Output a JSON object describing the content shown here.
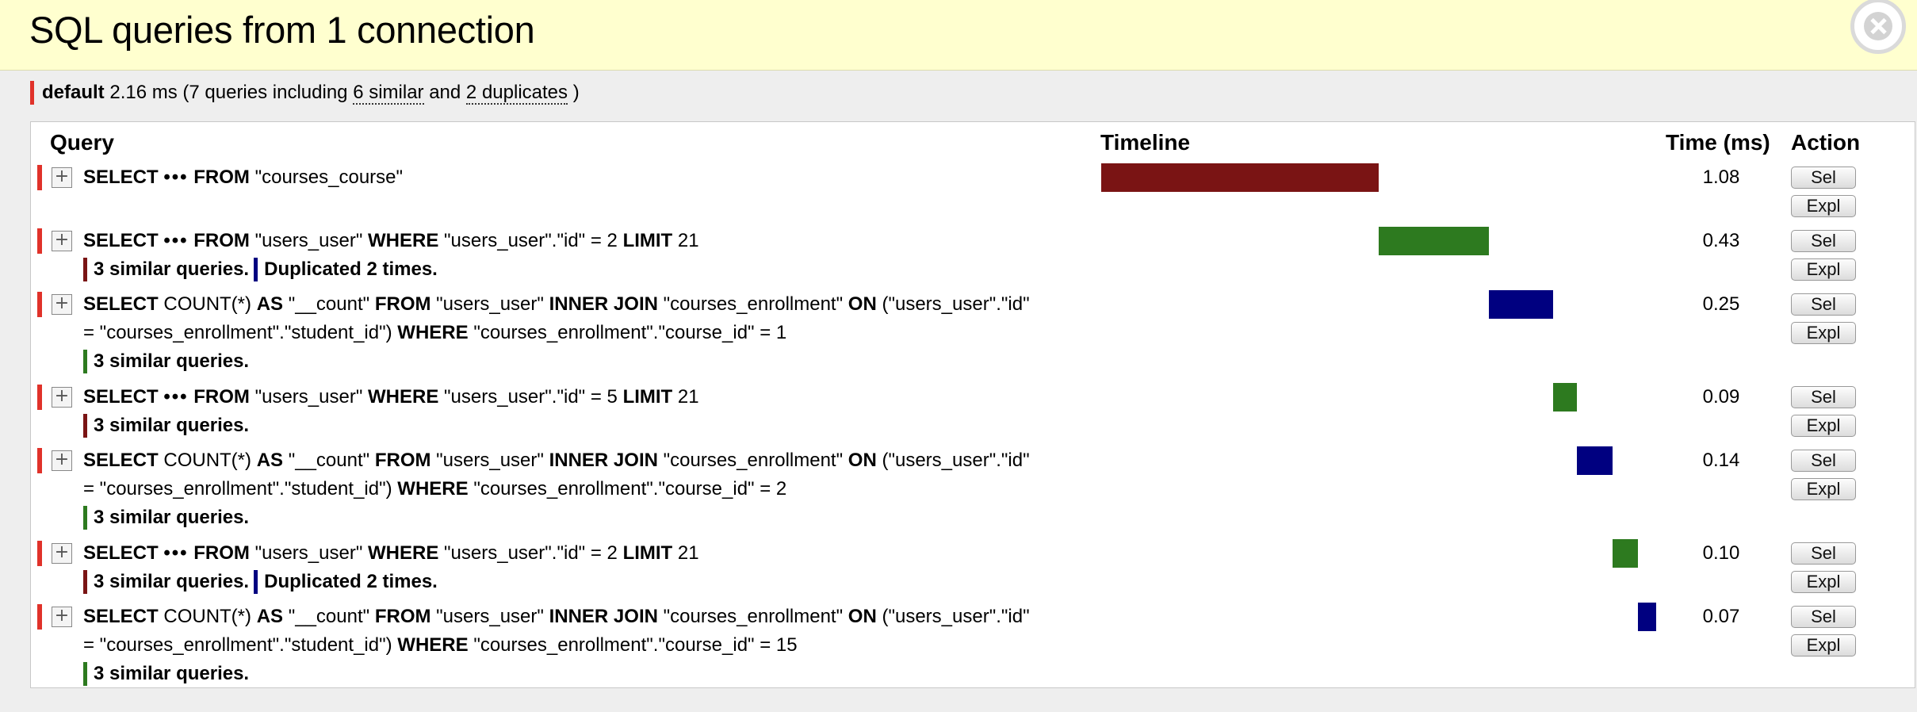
{
  "header": {
    "title": "SQL queries from 1 connection"
  },
  "summary": {
    "alias": "default",
    "time": "2.16 ms",
    "prefix": "(7 queries including",
    "similar": "6 similar",
    "and": "and",
    "duplicates": "2 duplicates",
    "suffix": ")"
  },
  "columns": {
    "query": "Query",
    "timeline": "Timeline",
    "time": "Time (ms)",
    "action": "Action"
  },
  "buttons": {
    "sel": "Sel",
    "expl": "Expl"
  },
  "expand_glyph": "+",
  "ellipsis": "•••",
  "colors": {
    "maroon": "#7a1414",
    "green": "#2d7a1f",
    "navy": "#000080",
    "accent_red": "#e0322a"
  },
  "queries": [
    {
      "lines": [
        [
          [
            "k",
            "SELECT"
          ],
          [
            "e",
            "•••"
          ],
          [
            "k",
            "FROM"
          ],
          [
            "t",
            "\"courses_course\""
          ]
        ]
      ],
      "notes": [],
      "time": "1.08",
      "bar_color": "maroon"
    },
    {
      "lines": [
        [
          [
            "k",
            "SELECT"
          ],
          [
            "e",
            "•••"
          ],
          [
            "k",
            "FROM"
          ],
          [
            "t",
            "\"users_user\""
          ],
          [
            "k",
            "WHERE"
          ],
          [
            "t",
            "\"users_user\".\"id\" = 2"
          ],
          [
            "k",
            "LIMIT"
          ],
          [
            "t",
            "21"
          ]
        ]
      ],
      "notes": [
        {
          "color": "maroon",
          "text": "3 similar queries."
        },
        {
          "color": "navy",
          "text": "Duplicated 2 times."
        }
      ],
      "time": "0.43",
      "bar_color": "green"
    },
    {
      "lines": [
        [
          [
            "k",
            "SELECT"
          ],
          [
            "t",
            "COUNT(*)"
          ],
          [
            "k",
            "AS"
          ],
          [
            "t",
            "\"__count\""
          ],
          [
            "k",
            "FROM"
          ],
          [
            "t",
            "\"users_user\""
          ],
          [
            "k",
            "INNER JOIN"
          ],
          [
            "t",
            "\"courses_enrollment\""
          ],
          [
            "k",
            "ON"
          ],
          [
            "t",
            "(\"users_user\".\"id\""
          ]
        ],
        [
          [
            "t",
            "= \"courses_enrollment\".\"student_id\")"
          ],
          [
            "k",
            "WHERE"
          ],
          [
            "t",
            "\"courses_enrollment\".\"course_id\" = 1"
          ]
        ]
      ],
      "notes": [
        {
          "color": "green",
          "text": "3 similar queries."
        }
      ],
      "time": "0.25",
      "bar_color": "navy"
    },
    {
      "lines": [
        [
          [
            "k",
            "SELECT"
          ],
          [
            "e",
            "•••"
          ],
          [
            "k",
            "FROM"
          ],
          [
            "t",
            "\"users_user\""
          ],
          [
            "k",
            "WHERE"
          ],
          [
            "t",
            "\"users_user\".\"id\" = 5"
          ],
          [
            "k",
            "LIMIT"
          ],
          [
            "t",
            "21"
          ]
        ]
      ],
      "notes": [
        {
          "color": "maroon",
          "text": "3 similar queries."
        }
      ],
      "time": "0.09",
      "bar_color": "green"
    },
    {
      "lines": [
        [
          [
            "k",
            "SELECT"
          ],
          [
            "t",
            "COUNT(*)"
          ],
          [
            "k",
            "AS"
          ],
          [
            "t",
            "\"__count\""
          ],
          [
            "k",
            "FROM"
          ],
          [
            "t",
            "\"users_user\""
          ],
          [
            "k",
            "INNER JOIN"
          ],
          [
            "t",
            "\"courses_enrollment\""
          ],
          [
            "k",
            "ON"
          ],
          [
            "t",
            "(\"users_user\".\"id\""
          ]
        ],
        [
          [
            "t",
            "= \"courses_enrollment\".\"student_id\")"
          ],
          [
            "k",
            "WHERE"
          ],
          [
            "t",
            "\"courses_enrollment\".\"course_id\" = 2"
          ]
        ]
      ],
      "notes": [
        {
          "color": "green",
          "text": "3 similar queries."
        }
      ],
      "time": "0.14",
      "bar_color": "navy"
    },
    {
      "lines": [
        [
          [
            "k",
            "SELECT"
          ],
          [
            "e",
            "•••"
          ],
          [
            "k",
            "FROM"
          ],
          [
            "t",
            "\"users_user\""
          ],
          [
            "k",
            "WHERE"
          ],
          [
            "t",
            "\"users_user\".\"id\" = 2"
          ],
          [
            "k",
            "LIMIT"
          ],
          [
            "t",
            "21"
          ]
        ]
      ],
      "notes": [
        {
          "color": "maroon",
          "text": "3 similar queries."
        },
        {
          "color": "navy",
          "text": "Duplicated 2 times."
        }
      ],
      "time": "0.10",
      "bar_color": "green"
    },
    {
      "lines": [
        [
          [
            "k",
            "SELECT"
          ],
          [
            "t",
            "COUNT(*)"
          ],
          [
            "k",
            "AS"
          ],
          [
            "t",
            "\"__count\""
          ],
          [
            "k",
            "FROM"
          ],
          [
            "t",
            "\"users_user\""
          ],
          [
            "k",
            "INNER JOIN"
          ],
          [
            "t",
            "\"courses_enrollment\""
          ],
          [
            "k",
            "ON"
          ],
          [
            "t",
            "(\"users_user\".\"id\""
          ]
        ],
        [
          [
            "t",
            "= \"courses_enrollment\".\"student_id\")"
          ],
          [
            "k",
            "WHERE"
          ],
          [
            "t",
            "\"courses_enrollment\".\"course_id\" = 15"
          ]
        ]
      ],
      "notes": [
        {
          "color": "green",
          "text": "3 similar queries."
        }
      ],
      "time": "0.07",
      "bar_color": "navy"
    }
  ]
}
